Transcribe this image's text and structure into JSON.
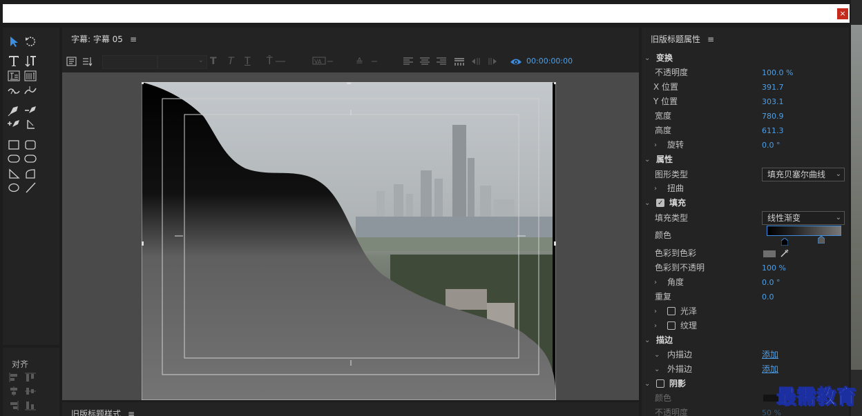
{
  "window": {
    "close_label": "×"
  },
  "tools_panel": {
    "align_label": "对齐"
  },
  "title_panel": {
    "title": "字幕: 字幕 05",
    "menu_icon": "≡",
    "timecode": "00:00:00:00"
  },
  "bottom_panel": {
    "title": "旧版标题样式"
  },
  "properties": {
    "title": "旧版标题属性",
    "transform": {
      "section": "变换",
      "opacity_label": "不透明度",
      "opacity_value": "100.0 %",
      "x_label": "X 位置",
      "x_value": "391.7",
      "y_label": "Y 位置",
      "y_value": "303.1",
      "width_label": "宽度",
      "width_value": "780.9",
      "height_label": "高度",
      "height_value": "611.3",
      "rotation_label": "旋转",
      "rotation_value": "0.0 °"
    },
    "attributes": {
      "section": "属性",
      "shape_type_label": "图形类型",
      "shape_type_value": "填充贝塞尔曲线",
      "distort_label": "扭曲"
    },
    "fill": {
      "section": "填充",
      "fill_type_label": "填充类型",
      "fill_type_value": "线性渐变",
      "color_label": "颜色",
      "color_to_color_label": "色彩到色彩",
      "color_to_opacity_label": "色彩到不透明",
      "color_to_opacity_value": "100 %",
      "angle_label": "角度",
      "angle_value": "0.0 °",
      "repeat_label": "重复",
      "repeat_value": "0.0",
      "sheen_label": "光泽",
      "texture_label": "纹理"
    },
    "stroke": {
      "section": "描边",
      "inner_label": "内描边",
      "inner_link": "添加",
      "outer_label": "外描边",
      "outer_link": "添加"
    },
    "shadow": {
      "section": "阴影",
      "color_label": "颜色",
      "opacity_label": "不透明度",
      "opacity_value": "50 %"
    }
  },
  "watermark": "最需教育",
  "colors": {
    "accent": "#4f9fe6",
    "panel": "#232323",
    "close": "#c42b1c"
  },
  "icons": [
    "selection-tool-icon",
    "rotate-tool-icon",
    "type-tool-icon",
    "vertical-type-tool-icon",
    "pen-tool-icon",
    "rectangle-tool-icon",
    "ellipse-tool-icon",
    "line-tool-icon",
    "eyedropper-icon",
    "eye-icon"
  ]
}
